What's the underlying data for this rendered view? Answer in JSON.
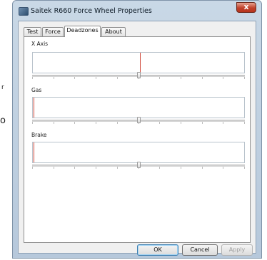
{
  "edge_marks": [
    "r",
    "o"
  ],
  "window": {
    "title": "Saitek R660 Force Wheel Properties",
    "close_symbol": "x"
  },
  "tabs": [
    {
      "label": "Test",
      "active": false
    },
    {
      "label": "Force",
      "active": false
    },
    {
      "label": "Deadzones",
      "active": true
    },
    {
      "label": "About",
      "active": false
    }
  ],
  "axes": [
    {
      "label": "X Axis",
      "slider_value": 0.5
    },
    {
      "label": "Gas",
      "slider_value": 0.5
    },
    {
      "label": "Brake",
      "slider_value": 0.5
    }
  ],
  "buttons": {
    "ok": "OK",
    "cancel": "Cancel",
    "apply": "Apply"
  }
}
